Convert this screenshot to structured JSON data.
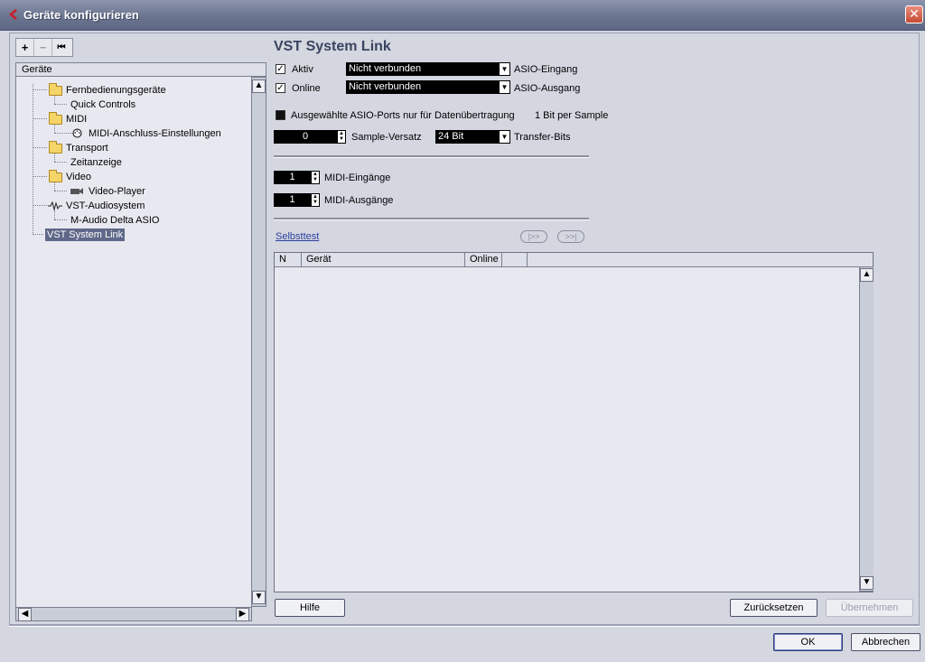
{
  "window": {
    "title": "Geräte konfigurieren",
    "close_glyph": "✕"
  },
  "toolbar": {
    "add": "+",
    "remove": "−",
    "reset": "⏮"
  },
  "tree": {
    "header": "Geräte",
    "items": [
      {
        "label": "Fernbedienungsgeräte",
        "icon": "folder-icon"
      },
      {
        "label": "Quick Controls"
      },
      {
        "label": "MIDI",
        "icon": "folder-icon"
      },
      {
        "label": "MIDI-Anschluss-Einstellungen",
        "icon": "midi-port-icon"
      },
      {
        "label": "Transport",
        "icon": "folder-icon"
      },
      {
        "label": "Zeitanzeige"
      },
      {
        "label": "Video",
        "icon": "folder-icon"
      },
      {
        "label": "Video-Player",
        "icon": "video-icon"
      },
      {
        "label": "VST-Audiosystem",
        "icon": "audio-system-icon"
      },
      {
        "label": "M-Audio Delta ASIO"
      },
      {
        "label": "VST System Link",
        "selected": true
      }
    ]
  },
  "panel": {
    "title": "VST System Link",
    "aktiv": {
      "label": "Aktiv",
      "checked": true,
      "value": "Nicht verbunden",
      "side_label": "ASIO-Eingang"
    },
    "online": {
      "label": "Online",
      "checked": true,
      "value": "Nicht verbunden",
      "side_label": "ASIO-Ausgang"
    },
    "asio_ports": {
      "label": "Ausgewählte ASIO-Ports nur für Datenübertragung",
      "checked": false,
      "side_label": "1 Bit per Sample"
    },
    "sample_offset": {
      "value": "0",
      "label": "Sample-Versatz"
    },
    "transfer_bits": {
      "value": "24 Bit",
      "label": "Transfer-Bits"
    },
    "midi_in": {
      "value": "1",
      "label": "MIDI-Eingänge"
    },
    "midi_out": {
      "value": "1",
      "label": "MIDI-Ausgänge"
    },
    "selftest": "Selbsttest",
    "transport_play": "|>>",
    "transport_end": ">>|",
    "table": {
      "columns": [
        "N",
        "Gerät",
        "Online",
        ""
      ],
      "rows": []
    }
  },
  "buttons": {
    "help": "Hilfe",
    "reset": "Zurücksetzen",
    "apply": "Übernehmen",
    "ok": "OK",
    "cancel": "Abbrechen"
  }
}
